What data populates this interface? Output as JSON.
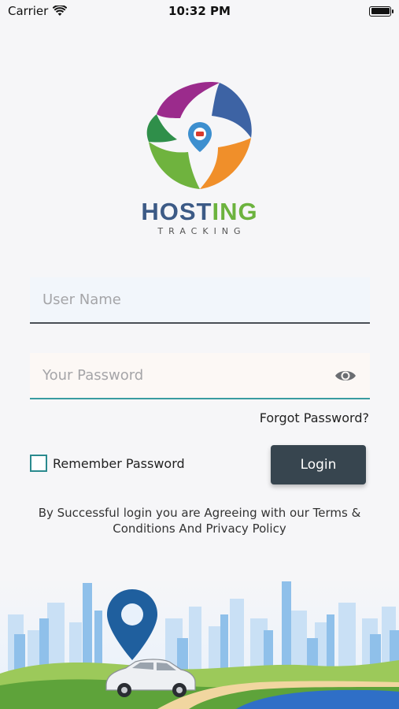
{
  "status_bar": {
    "carrier": "Carrier",
    "time": "10:32 PM"
  },
  "brand": {
    "name_part1": "HOST",
    "name_part2": "ING",
    "subtitle": "TRACKING"
  },
  "form": {
    "username_placeholder": "User Name",
    "password_placeholder": "Your Password",
    "forgot_label": "Forgot Password?",
    "remember_label": "Remember Password",
    "login_label": "Login",
    "remember_checked": false
  },
  "terms_text": "By Successful login you are Agreeing with our Terms & Conditions And Privacy Policy",
  "colors": {
    "brand_blue": "#3c5a86",
    "brand_green": "#6cb33e",
    "button_bg": "#37454f",
    "accent_teal": "#2a8a8e"
  },
  "icons": [
    "wifi-icon",
    "battery-icon",
    "brand-logo-icon",
    "eye-icon",
    "location-pin-icon",
    "car-icon"
  ]
}
